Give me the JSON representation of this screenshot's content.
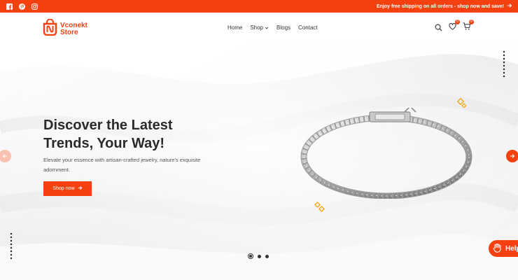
{
  "topbar": {
    "social_icons": [
      "facebook-icon",
      "pinterest-icon",
      "instagram-icon"
    ],
    "promo_text": "Enjoy free shipping on all orders - shop now and save!"
  },
  "header": {
    "logo": {
      "line1": "Vconekt",
      "line2": "Store"
    },
    "nav": [
      {
        "label": "Home"
      },
      {
        "label": "Shop",
        "has_dropdown": true
      },
      {
        "label": "Blogs"
      },
      {
        "label": "Contact"
      }
    ],
    "icons": {
      "search": "search-icon",
      "wishlist": {
        "icon": "heart-icon",
        "count": "0"
      },
      "cart": {
        "icon": "cart-icon",
        "count": "0"
      }
    }
  },
  "hero": {
    "title": "Discover the Latest Trends, Your Way!",
    "subtitle": "Elevate your essence with artisan-crafted jewelry, nature's exquisite adornment.",
    "cta_label": "Shop now",
    "slides_count": 3,
    "active_slide": 1
  },
  "help_widget": {
    "label": "Help"
  },
  "colors": {
    "accent": "#f5400f",
    "accent_light": "#f8c1b0",
    "text_dark": "#2a2a2a"
  }
}
